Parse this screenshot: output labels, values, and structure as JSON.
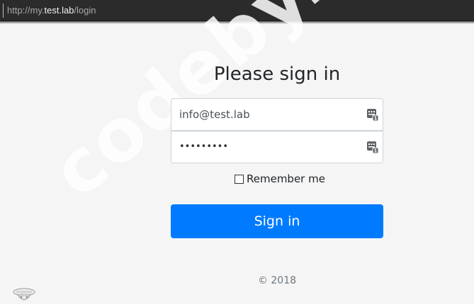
{
  "browser": {
    "url_prefix": "http://my.",
    "url_host": "test.lab",
    "url_path": "/login"
  },
  "watermark": {
    "text": "codeby.net"
  },
  "form": {
    "heading": "Please sign in",
    "email_value": "info@test.lab",
    "password_masked": "•••••••••",
    "password_manager_icon": "password-manager-key-icon",
    "remember_label": "Remember me",
    "remember_checked": false,
    "submit_label": "Sign in"
  },
  "footer": {
    "copyright": "© 2018"
  },
  "colors": {
    "primary": "#007bff",
    "background": "#f5f5f5",
    "chrome": "#2b2b2b",
    "text": "#212529",
    "muted": "#6c757d"
  }
}
